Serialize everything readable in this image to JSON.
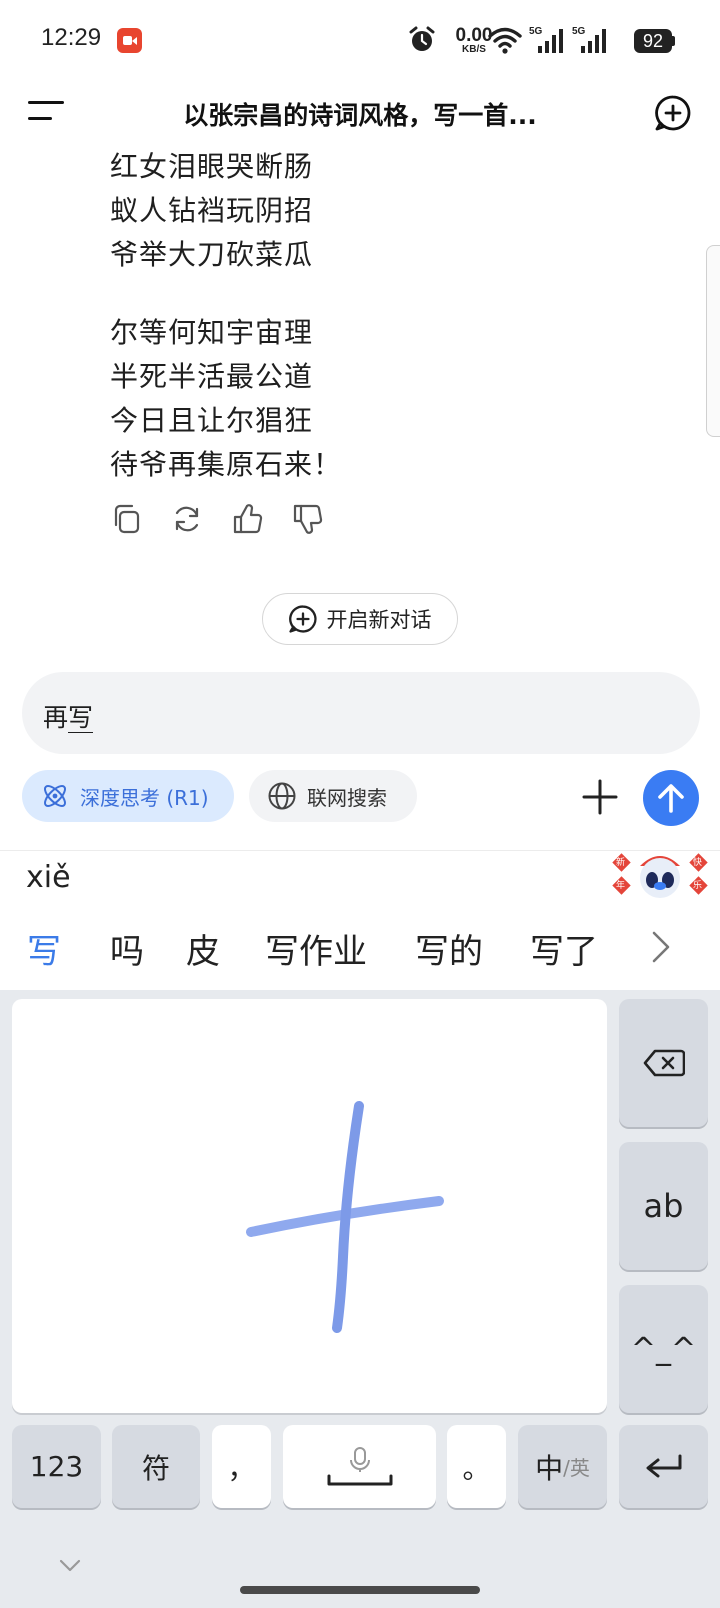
{
  "status_bar": {
    "time": "12:29",
    "net_speed_value": "0.00",
    "net_speed_unit": "KB/S",
    "sim1_label": "5G",
    "sim2_label": "5G",
    "battery": "92"
  },
  "header": {
    "title": "以张宗昌的诗词风格，写一首..."
  },
  "poem": {
    "stanza1": [
      "红女泪眼哭断肠",
      "蚁人钻裆玩阴招",
      "爷举大刀砍菜瓜"
    ],
    "stanza2": [
      "尔等何知宇宙理",
      "半死半活最公道",
      "今日且让尔猖狂",
      "待爷再集原石来！"
    ]
  },
  "actions": {
    "icons": [
      "copy-icon",
      "regenerate-icon",
      "thumbs-up-icon",
      "thumbs-down-icon"
    ]
  },
  "new_chat": {
    "label": "开启新对话"
  },
  "input": {
    "prefix": "再",
    "composing": "写"
  },
  "toolbar": {
    "deep_think": "深度思考 (R1)",
    "web_search": "联网搜索"
  },
  "keyboard": {
    "pinyin": "xiě",
    "candidates": [
      "写",
      "吗",
      "皮",
      "写作业",
      "写的",
      "写了"
    ],
    "side_keys": {
      "ab": "ab",
      "emoticon": "^_^"
    },
    "bottom": {
      "num": "123",
      "symbol": "符",
      "comma": "，",
      "period": "。",
      "lang_main": "中",
      "lang_alt": "/英"
    },
    "mascot_labels": [
      "新",
      "年",
      "快",
      "乐"
    ]
  },
  "colors": {
    "accent": "#3a7cf3",
    "deep_think_bg": "#dbeafe",
    "stroke": "#8fa9ee"
  }
}
